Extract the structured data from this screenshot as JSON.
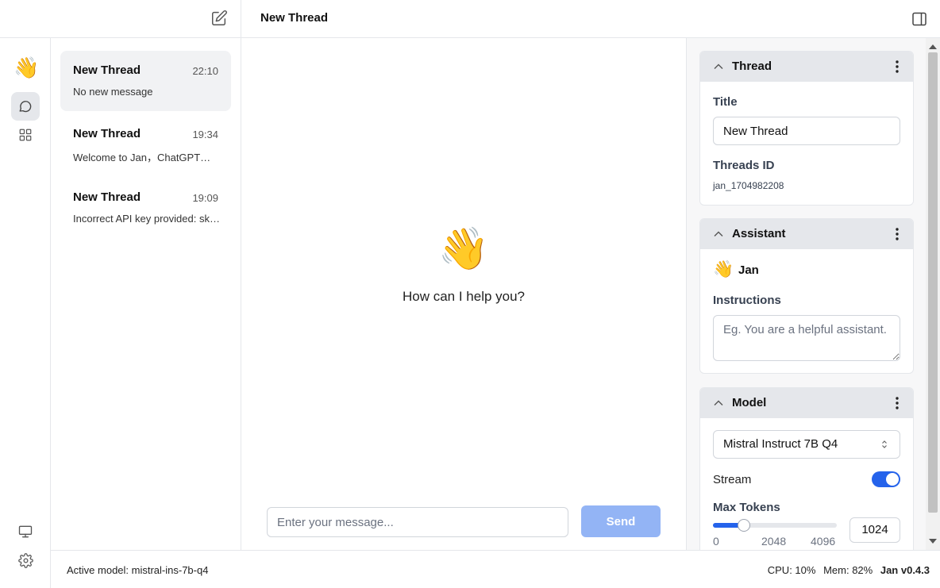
{
  "header": {
    "title": "New Thread"
  },
  "rail": {
    "logo": "👋"
  },
  "threads": [
    {
      "name": "New Thread",
      "time": "22:10",
      "message": "No new message"
    },
    {
      "name": "New Thread",
      "time": "19:34",
      "message": "Welcome to Jan，ChatGPT的替代方案"
    },
    {
      "name": "New Thread",
      "time": "19:09",
      "message": "Incorrect API key provided: sk-xxxx"
    }
  ],
  "main": {
    "emoji": "👋",
    "greeting": "How can I help you?",
    "input_placeholder": "Enter your message...",
    "send_label": "Send"
  },
  "panel": {
    "thread": {
      "title": "Thread",
      "title_label": "Title",
      "title_value": "New Thread",
      "id_label": "Threads ID",
      "id_value": "jan_1704982208"
    },
    "assistant": {
      "title": "Assistant",
      "emoji": "👋",
      "name": "Jan",
      "instructions_label": "Instructions",
      "instructions_placeholder": "Eg. You are a helpful assistant."
    },
    "model": {
      "title": "Model",
      "selected": "Mistral Instruct 7B Q4",
      "stream_label": "Stream",
      "stream_on": true,
      "max_tokens_label": "Max Tokens",
      "max_tokens_value": "1024",
      "slider_min": "0",
      "slider_mid": "2048",
      "slider_max": "4096"
    }
  },
  "status": {
    "active_model": "Active model: mistral-ins-7b-q4",
    "cpu": "CPU: 10%",
    "mem": "Mem: 82%",
    "version": "Jan v0.4.3"
  },
  "colors": {
    "accent": "#2563eb",
    "send_disabled": "#93b4f5",
    "card_header": "#e5e7eb"
  }
}
